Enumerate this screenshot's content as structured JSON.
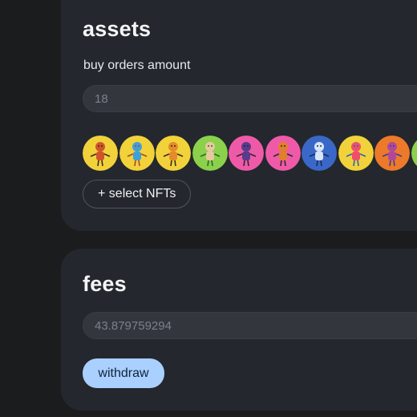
{
  "assets": {
    "title": "assets",
    "buy_orders_label": "buy orders amount",
    "buy_orders_placeholder": "18",
    "select_nfts_label": "+ select NFTs",
    "nfts": [
      {
        "name": "nft-avatar-1",
        "bg": "#f2d23a",
        "figure": "#d0542b",
        "accent": "#3a2c22"
      },
      {
        "name": "nft-avatar-2",
        "bg": "#f2d23a",
        "figure": "#3fa0d8",
        "accent": "#b0442a"
      },
      {
        "name": "nft-avatar-3",
        "bg": "#f2d23a",
        "figure": "#e58a2b",
        "accent": "#3a2c22"
      },
      {
        "name": "nft-avatar-4",
        "bg": "#8bd14b",
        "figure": "#e9c8a0",
        "accent": "#2a6a2a"
      },
      {
        "name": "nft-avatar-5",
        "bg": "#ef5aa8",
        "figure": "#5a3a8a",
        "accent": "#2a2a2a"
      },
      {
        "name": "nft-avatar-6",
        "bg": "#ef5aa8",
        "figure": "#e0802a",
        "accent": "#2a2a2a"
      },
      {
        "name": "nft-avatar-7",
        "bg": "#3a68c8",
        "figure": "#d9e6f7",
        "accent": "#1a2a5a"
      },
      {
        "name": "nft-avatar-8",
        "bg": "#f2d23a",
        "figure": "#ef4f6a",
        "accent": "#2a60c0"
      },
      {
        "name": "nft-avatar-9",
        "bg": "#ec7a2a",
        "figure": "#b0489a",
        "accent": "#3a3aa0"
      },
      {
        "name": "nft-avatar-10",
        "bg": "#8bd14b",
        "figure": "#e9c8a0",
        "accent": "#2a6a2a"
      }
    ]
  },
  "fees": {
    "title": "fees",
    "amount_placeholder": "43.879759294",
    "withdraw_label": "withdraw"
  },
  "colors": {
    "page_bg": "#1b1c1e",
    "card_bg": "#24272d",
    "input_bg": "#33363d",
    "primary_button": "#a9d0ff"
  }
}
